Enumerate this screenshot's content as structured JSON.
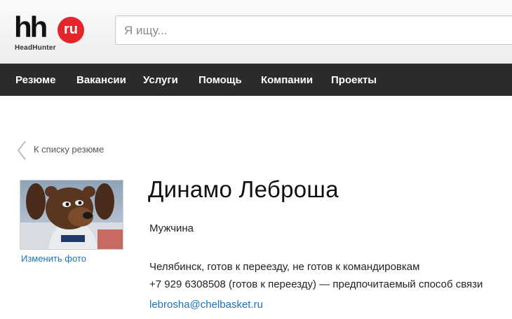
{
  "header": {
    "logo_main": "hh",
    "logo_badge": "ru",
    "logo_sub": "HeadHunter",
    "search_placeholder": "Я ищу..."
  },
  "nav": {
    "items": [
      {
        "label": "Резюме"
      },
      {
        "label": "Вакансии"
      },
      {
        "label": "Услуги"
      },
      {
        "label": "Помощь"
      },
      {
        "label": "Компании"
      },
      {
        "label": "Проекты"
      }
    ]
  },
  "back_link": {
    "label": "К списку резюме"
  },
  "profile": {
    "change_photo_label": "Изменить фото",
    "name": "Динамо Леброша",
    "gender": "Мужчина",
    "location": "Челябинск, готов к переезду, не готов к командировкам",
    "phone": "+7 929 6308508 (готов к переезду) — предпочитаемый способ связи",
    "email": "lebrosha@chelbasket.ru"
  },
  "colors": {
    "nav_background": "#2b2b2b",
    "logo_badge": "#e4262c",
    "link": "#1a73b8"
  },
  "icons": [
    "back-chevron-icon"
  ]
}
